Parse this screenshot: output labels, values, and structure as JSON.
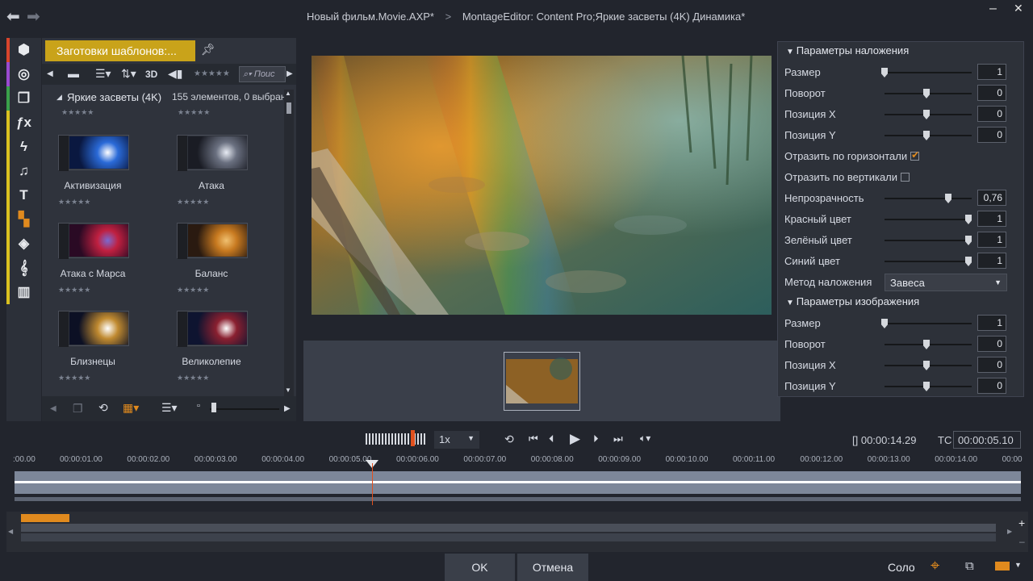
{
  "window": {
    "title_project": "Новый фильм.Movie.AXP*",
    "title_sep": ">",
    "title_editor": "MontageEditor: Content Pro;Яркие засветы (4K)  Динамика*",
    "back_icon": "back-arrow-icon",
    "forward_icon": "forward-arrow-icon",
    "minimize": "–",
    "close": "✕"
  },
  "sidebar": {
    "tools": [
      {
        "name": "library-icon",
        "glyph": "⬢",
        "color": "#d8442c"
      },
      {
        "name": "reel-icon",
        "glyph": "◎",
        "color": "#9a4ad0"
      },
      {
        "name": "layers-icon",
        "glyph": "❐",
        "color": "#3aa04a"
      },
      {
        "name": "fx-icon",
        "glyph": "ƒx",
        "color": "#d9c020"
      },
      {
        "name": "lightning-icon",
        "glyph": "ϟ",
        "color": "#d9c020"
      },
      {
        "name": "music-icon",
        "glyph": "♫",
        "color": "#d9c020"
      },
      {
        "name": "title-icon",
        "glyph": "T",
        "color": "#d9c020"
      },
      {
        "name": "montage-icon",
        "glyph": "▚",
        "color": "#d9c020"
      },
      {
        "name": "stack-icon",
        "glyph": "◈",
        "color": "#d9c020"
      },
      {
        "name": "sound-icon",
        "glyph": "𝄞",
        "color": "#d9c020"
      },
      {
        "name": "piano-icon",
        "glyph": "▥",
        "color": "#d9c020"
      }
    ]
  },
  "library": {
    "tab_label": "Заготовки шаблонов:...",
    "toolbar_3d": "3D",
    "search_placeholder": "Поис",
    "folder_name": "Яркие засветы (4K)",
    "folder_info": "155 элементов, 0 выбран",
    "stars": "★★★★★",
    "items": [
      {
        "name": "Активизация",
        "c1": "#0a1840",
        "c2": "#2a6ad8",
        "c3": "#ffffff"
      },
      {
        "name": "Атака",
        "c1": "#1a1c24",
        "c2": "#6a7080",
        "c3": "#e8ecf4"
      },
      {
        "name": "Атака с Марса",
        "c1": "#2a0a24",
        "c2": "#c02040",
        "c3": "#7a6ad0"
      },
      {
        "name": "Баланс",
        "c1": "#2a1a10",
        "c2": "#c87a20",
        "c3": "#f0c070"
      },
      {
        "name": "Близнецы",
        "c1": "#0c1024",
        "c2": "#c08a30",
        "c3": "#ffffff"
      },
      {
        "name": "Великолепие",
        "c1": "#0e1430",
        "c2": "#8a2030",
        "c3": "#ffffff"
      }
    ]
  },
  "params": {
    "overlay_title": "Параметры наложения",
    "overlay_rows": [
      {
        "label": "Размер",
        "value": "1",
        "pos": 0
      },
      {
        "label": "Поворот",
        "value": "0",
        "pos": 0.5
      },
      {
        "label": "Позиция X",
        "value": "0",
        "pos": 0.5
      },
      {
        "label": "Позиция Y",
        "value": "0",
        "pos": 0.5
      }
    ],
    "flip_h": "Отразить по горизонтали",
    "flip_v": "Отразить по вертикали",
    "color_rows": [
      {
        "label": "Непрозрачность",
        "value": "0,76",
        "pos": 0.76
      },
      {
        "label": "Красный цвет",
        "value": "1",
        "pos": 1
      },
      {
        "label": "Зелёный цвет",
        "value": "1",
        "pos": 1
      },
      {
        "label": "Синий цвет",
        "value": "1",
        "pos": 1
      }
    ],
    "blend_label": "Метод наложения",
    "blend_value": "Завеса",
    "image_title": "Параметры изображения",
    "image_rows": [
      {
        "label": "Размер",
        "value": "1",
        "pos": 0
      },
      {
        "label": "Поворот",
        "value": "0",
        "pos": 0.5
      },
      {
        "label": "Позиция X",
        "value": "0",
        "pos": 0.5
      },
      {
        "label": "Позиция Y",
        "value": "0",
        "pos": 0.5
      }
    ]
  },
  "transport": {
    "speed": "1x",
    "duration": "[] 00:00:14.29",
    "tc_label": "TC",
    "tc_value": "00:00:05.10"
  },
  "ruler": [
    ":00.00",
    "00:00:01.00",
    "00:00:02.00",
    "00:00:03.00",
    "00:00:04.00",
    "00:00:05.00",
    "00:00:06.00",
    "00:00:07.00",
    "00:00:08.00",
    "00:00:09.00",
    "00:00:10.00",
    "00:00:11.00",
    "00:00:12.00",
    "00:00:13.00",
    "00:00:14.00",
    "00:00"
  ],
  "footer": {
    "ok": "OK",
    "cancel": "Отмена",
    "solo": "Соло"
  }
}
